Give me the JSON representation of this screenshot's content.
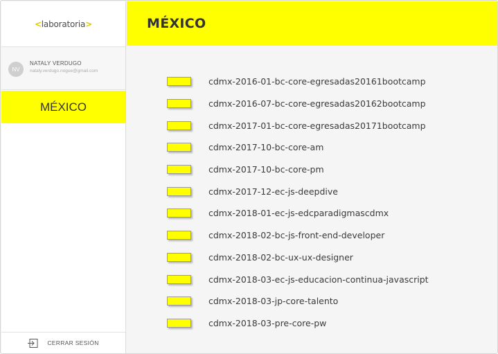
{
  "sidebar": {
    "logo": {
      "bracket_left": "<",
      "text": "laboratoria",
      "bracket_right": ">"
    },
    "user": {
      "initials": "NV",
      "name": "NATALY VERDUGO",
      "email": "nataly.verdugo.nogue@gmail.com"
    },
    "nav_item": "MÉXICO",
    "logout_icon": "logout-icon",
    "logout_label": "CERRAR SESIÓN"
  },
  "header": {
    "title": "MÉXICO"
  },
  "colors": {
    "accent": "#ffff00",
    "background": "#f5f5f5"
  },
  "cohorts": [
    "cdmx-2016-01-bc-core-egresadas20161bootcamp",
    "cdmx-2016-07-bc-core-egresadas20162bootcamp",
    "cdmx-2017-01-bc-core-egresadas20171bootcamp",
    "cdmx-2017-10-bc-core-am",
    "cdmx-2017-10-bc-core-pm",
    "cdmx-2017-12-ec-js-deepdive",
    "cdmx-2018-01-ec-js-edcparadigmascdmx",
    "cdmx-2018-02-bc-js-front-end-developer",
    "cdmx-2018-02-bc-ux-ux-designer",
    "cdmx-2018-03-ec-js-educacion-continua-javascript",
    "cdmx-2018-03-jp-core-talento",
    "cdmx-2018-03-pre-core-pw"
  ]
}
